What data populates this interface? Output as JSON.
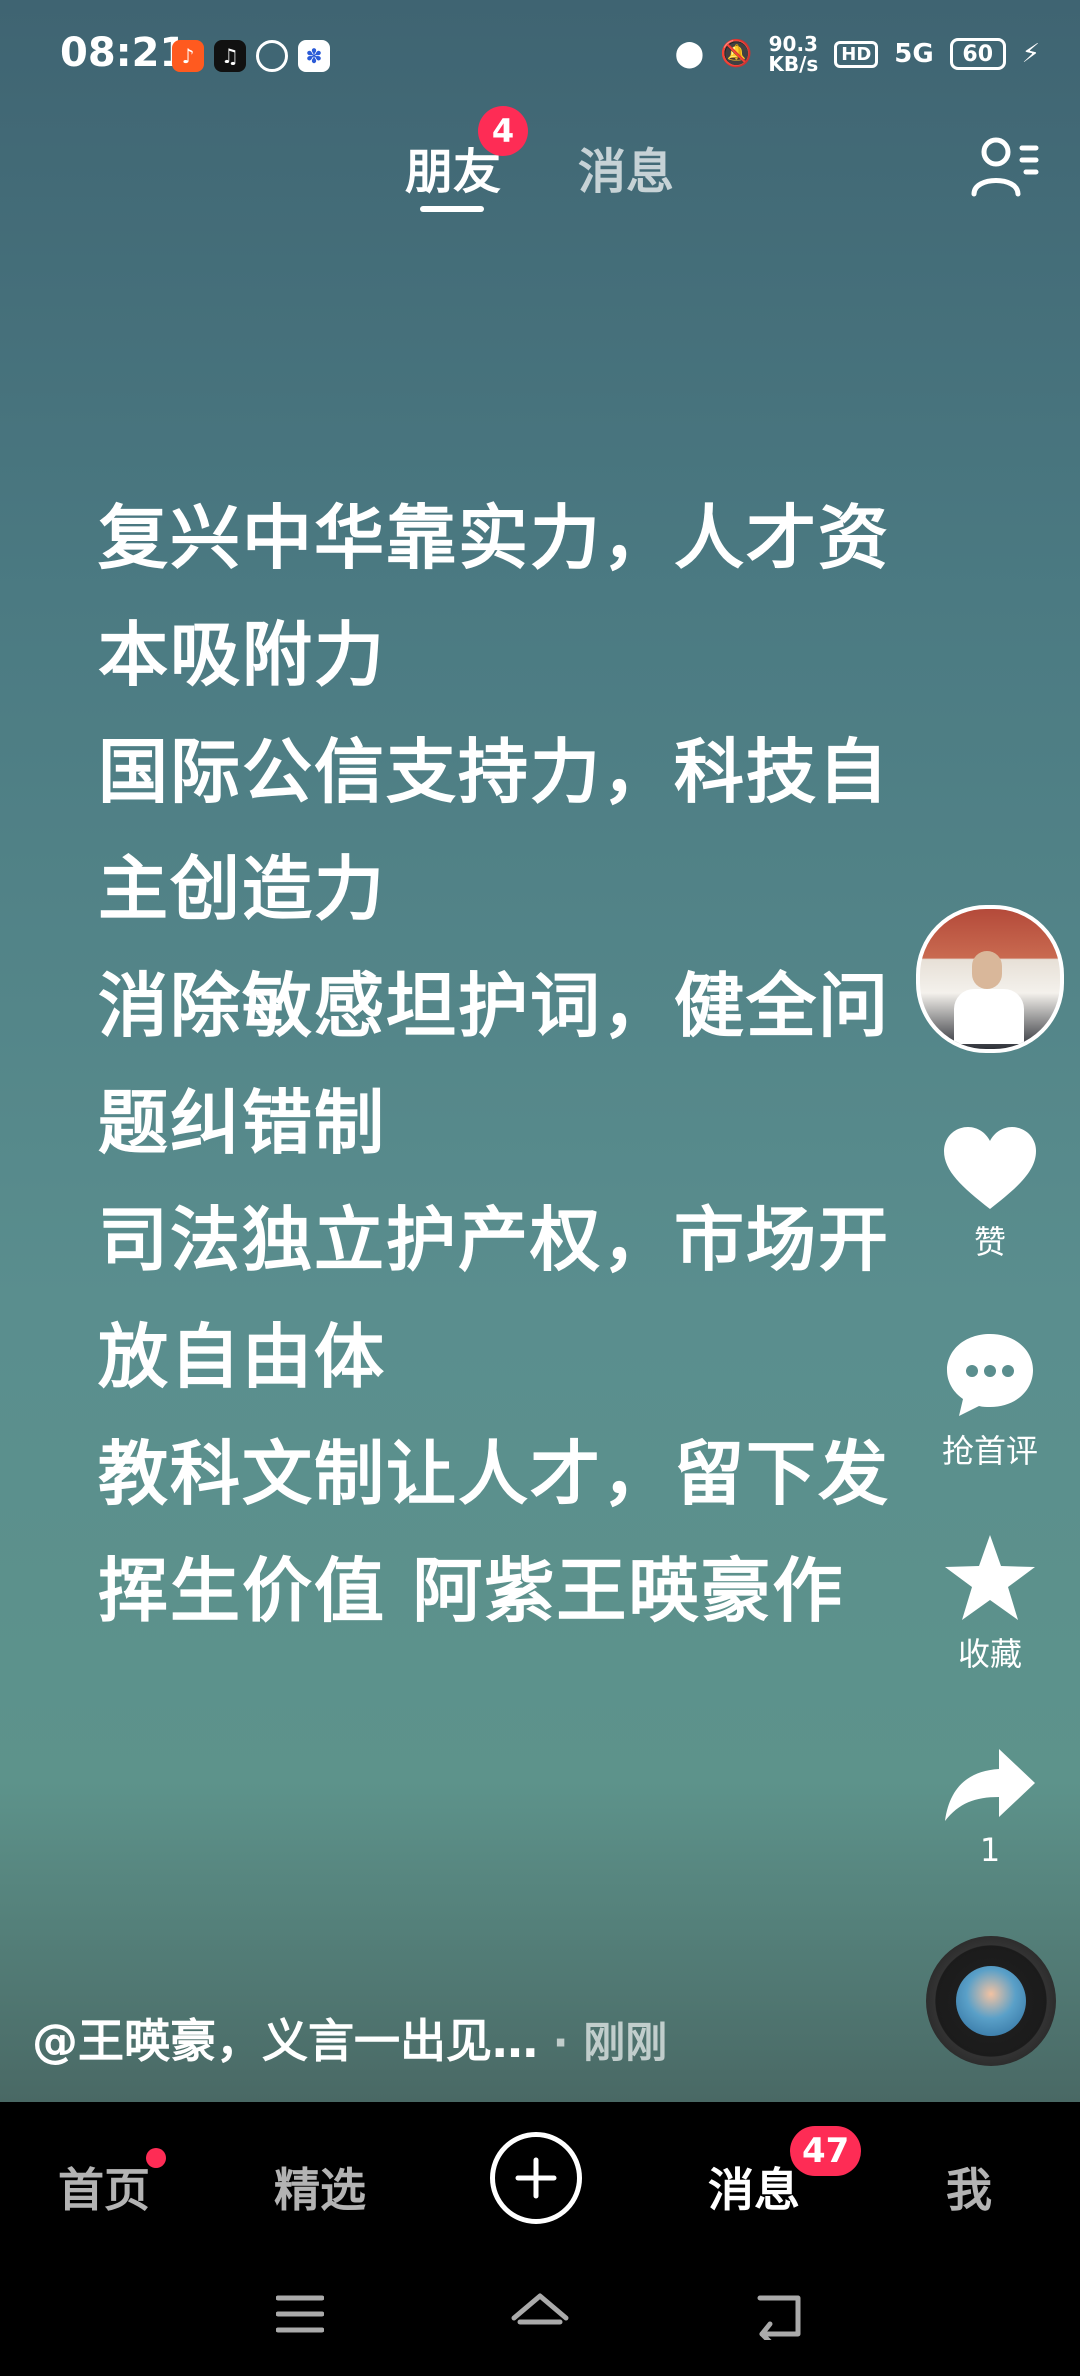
{
  "status_bar": {
    "time": "08:21",
    "app_icons": [
      "kuaishou-icon",
      "tiktok-icon",
      "ring-app-icon",
      "baidu-icon"
    ],
    "net_speed_value": "90.3",
    "net_speed_unit": "KB/s",
    "hd_label": "HD",
    "signal_label": "5G",
    "battery_level": "60"
  },
  "top_nav": {
    "tabs": [
      {
        "label": "朋友",
        "active": true,
        "badge": "4"
      },
      {
        "label": "消息",
        "active": false
      }
    ]
  },
  "post_lines": [
    "复兴中华靠实力，人才资",
    "本吸附力",
    "国际公信支持力，科技自",
    "主创造力",
    "消除敏感坦护词，健全问",
    "题纠错制",
    "司法独立护产权，市场开",
    "放自由体",
    "教科文制让人才，留下发",
    "挥生价值  阿紫王暎豪作"
  ],
  "actions": {
    "like_label": "赞",
    "comment_label": "抢首评",
    "favorite_label": "收藏",
    "share_count": "1"
  },
  "caption": {
    "text": "@王暎豪，义言一出见…",
    "separator": " · ",
    "time": "刚刚"
  },
  "bottom_tabs": {
    "home": "首页",
    "featured": "精选",
    "messages": "消息",
    "messages_badge": "47",
    "me": "我"
  },
  "colors": {
    "accent": "#fe2c55",
    "tabbar_bg": "#000000"
  }
}
